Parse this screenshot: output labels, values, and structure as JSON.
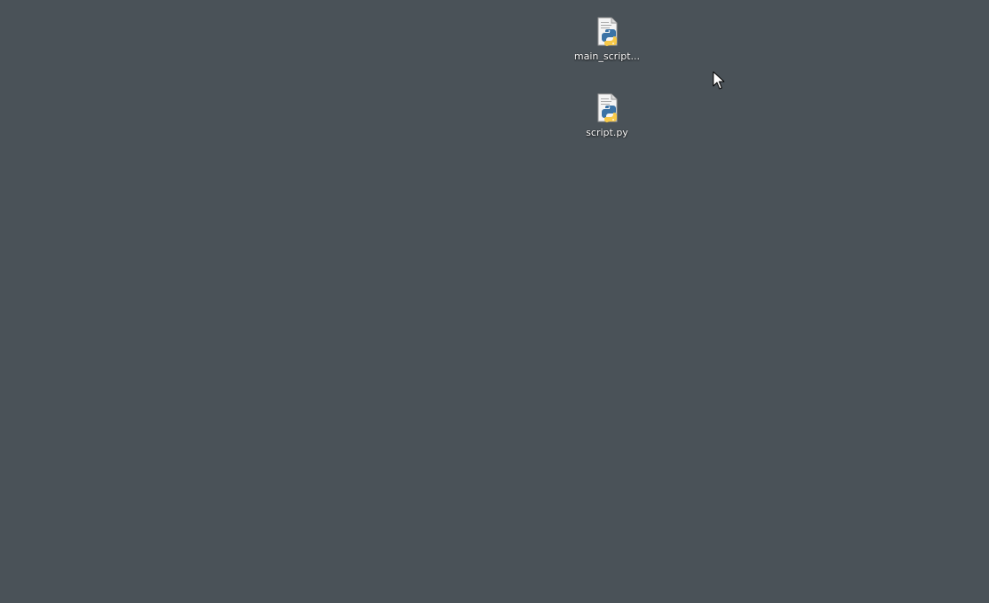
{
  "desktop": {
    "background_color": "#4a5258",
    "icons": [
      {
        "label": "main_script...",
        "icon": "python-file-icon"
      },
      {
        "label": "script.py",
        "icon": "python-file-icon"
      }
    ]
  },
  "cursor": {
    "icon": "mouse-pointer-icon"
  },
  "colors": {
    "python_blue": "#3b73a6",
    "python_yellow": "#f7c948",
    "label_text": "#ffffff"
  }
}
